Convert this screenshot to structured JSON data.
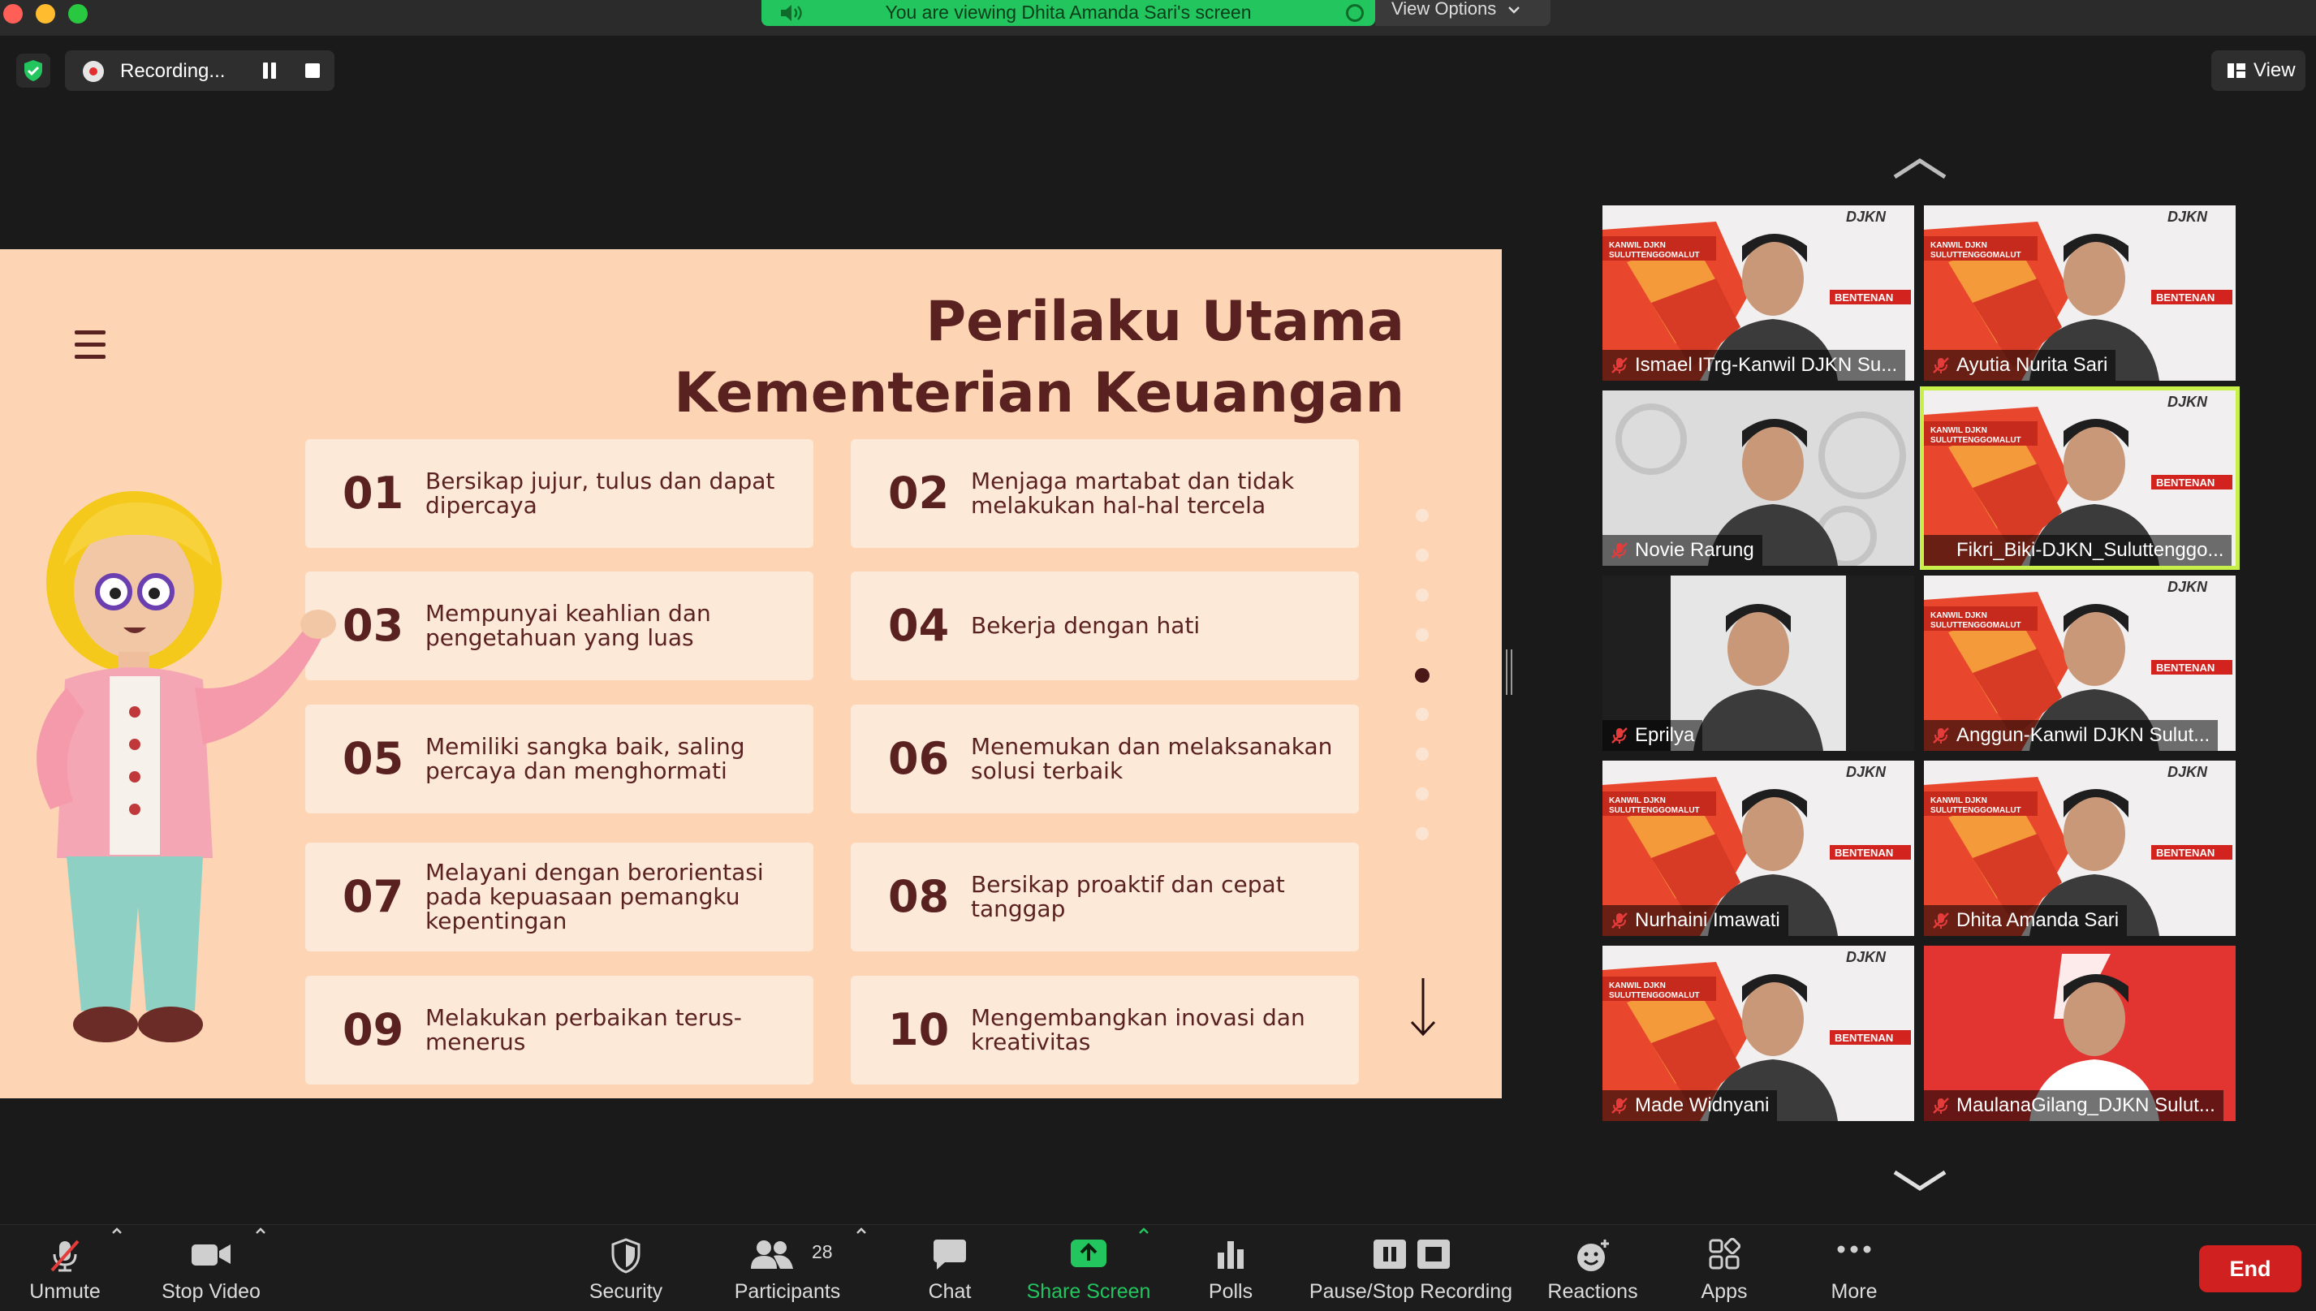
{
  "banner": {
    "text": "You are viewing Dhita Amanda Sari's screen",
    "view_options": "View Options"
  },
  "recording": {
    "label": "Recording..."
  },
  "view_button": {
    "label": "View"
  },
  "slide": {
    "title_line1": "Perilaku Utama",
    "title_line2": "Kementerian Keuangan",
    "items": [
      {
        "num": "01",
        "text": "Bersikap jujur, tulus dan dapat dipercaya"
      },
      {
        "num": "02",
        "text": "Menjaga martabat dan tidak melakukan hal-hal tercela"
      },
      {
        "num": "03",
        "text": "Mempunyai keahlian dan pengetahuan yang luas"
      },
      {
        "num": "04",
        "text": "Bekerja dengan hati"
      },
      {
        "num": "05",
        "text": "Memiliki sangka baik, saling percaya dan menghormati"
      },
      {
        "num": "06",
        "text": "Menemukan dan melaksanakan solusi terbaik"
      },
      {
        "num": "07",
        "text": "Melayani dengan berorientasi pada kepuasaan pemangku kepentingan"
      },
      {
        "num": "08",
        "text": "Bersikap proaktif dan cepat tanggap"
      },
      {
        "num": "09",
        "text": "Melakukan perbaikan terus-menerus"
      },
      {
        "num": "10",
        "text": "Mengembangkan inovasi dan kreativitas"
      }
    ],
    "pager": {
      "total": 9,
      "active": 5
    }
  },
  "participants_gallery": [
    {
      "name": "Ismael ITrg-Kanwil DJKN Su...",
      "bg": "brand",
      "muted": true
    },
    {
      "name": "Ayutia Nurita Sari",
      "bg": "brand",
      "muted": true
    },
    {
      "name": "Novie Rarung",
      "bg": "gray",
      "muted": true
    },
    {
      "name": "Fikri_Biki-DJKN_Suluttenggo...",
      "bg": "brand",
      "muted": false,
      "active_speaker": true
    },
    {
      "name": "Eprilya",
      "bg": "dark",
      "muted": true
    },
    {
      "name": "Anggun-Kanwil DJKN Sulut...",
      "bg": "brand",
      "muted": true
    },
    {
      "name": "Nurhaini Imawati",
      "bg": "brand",
      "muted": true
    },
    {
      "name": "Dhita Amanda Sari",
      "bg": "brand",
      "muted": true
    },
    {
      "name": "Made Widnyani",
      "bg": "brand",
      "muted": true
    },
    {
      "name": "MaulanaGilang_DJKN Sulut...",
      "bg": "red",
      "muted": true
    }
  ],
  "brand": {
    "logo": "DJKN",
    "tag": "BENTENAN",
    "region": "KANWIL DJKN SULUTTENGGOMALUT"
  },
  "toolbar": {
    "unmute": "Unmute",
    "stop_video": "Stop Video",
    "security": "Security",
    "participants": "Participants",
    "participants_count": "28",
    "chat": "Chat",
    "share_screen": "Share Screen",
    "polls": "Polls",
    "pause_stop_recording": "Pause/Stop Recording",
    "reactions": "Reactions",
    "apps": "Apps",
    "more": "More",
    "end": "End"
  },
  "colors": {
    "slide_bg": "#fdd5b5",
    "card_bg": "#fde9d8",
    "slide_text": "#5a2121",
    "banner_green": "#22c55e",
    "share_green": "#22c55e",
    "end_red": "#d0201f",
    "active_speaker": "#c7f04a"
  }
}
